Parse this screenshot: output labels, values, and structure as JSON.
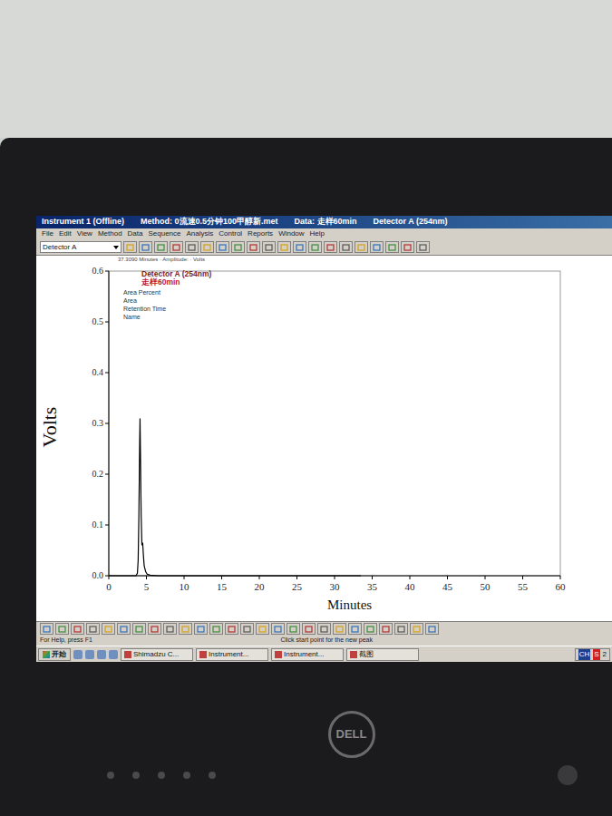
{
  "window": {
    "instrument": "Instrument 1 (Offline)",
    "method": "Method: 0流速0.5分钟100甲醇新.met",
    "data": "Data: 走样60min",
    "detector": "Detector A (254nm)"
  },
  "menu": [
    "File",
    "Edit",
    "View",
    "Method",
    "Data",
    "Sequence",
    "Analysis",
    "Control",
    "Reports",
    "Window",
    "Help"
  ],
  "toolbar": {
    "dropdown": "Detector A"
  },
  "info_line": "37.3090 Minutes · Amplitude: · Volts",
  "chart": {
    "legend": [
      "Detector A (254nm)",
      "走样60min",
      "Area Percent",
      "Area",
      "Retention Time",
      "Name"
    ],
    "y_label": "Volts",
    "x_label": "Minutes",
    "y_ticks": [
      "0.0",
      "0.1",
      "0.2",
      "0.3",
      "0.4",
      "0.5",
      "0.6"
    ],
    "x_ticks": [
      "0",
      "5",
      "10",
      "15",
      "20",
      "25",
      "30",
      "35",
      "40",
      "45",
      "50",
      "55",
      "60"
    ],
    "series": [
      {
        "name": "Detector A (254nm)",
        "color": "#000000",
        "times": [
          0,
          3.6,
          3.8,
          3.9,
          4.0,
          4.1,
          4.15,
          4.2,
          4.3,
          4.4,
          4.5,
          4.6,
          4.7,
          4.9,
          5.1,
          5.5,
          6.5,
          33.5
        ],
        "values": [
          0,
          0,
          0.005,
          0.03,
          0.12,
          0.26,
          0.31,
          0.25,
          0.12,
          0.06,
          0.065,
          0.04,
          0.02,
          0.008,
          0.003,
          0.001,
          0,
          0
        ]
      }
    ]
  },
  "status_bar": [
    "For Help, press F1",
    "Click start point for the new peak"
  ],
  "taskbar": {
    "start": "开始",
    "items": [
      "Shimadzu C...",
      "Instrument...",
      "Instrument...",
      "截图"
    ],
    "tray": [
      "CH",
      "S"
    ],
    "clock": "2"
  },
  "monitor": {
    "brand": "DELL"
  }
}
